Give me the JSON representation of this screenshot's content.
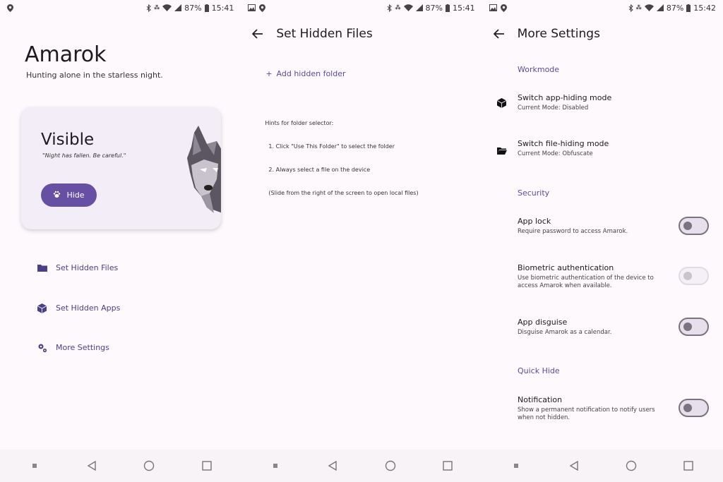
{
  "status_bars": [
    {
      "battery": "87%",
      "time": "15:41"
    },
    {
      "battery": "87%",
      "time": "15:41"
    },
    {
      "battery": "87%",
      "time": "15:42"
    }
  ],
  "home": {
    "title": "Amarok",
    "subtitle": "Hunting alone in the starless night.",
    "card": {
      "status": "Visible",
      "quote": "\"Night has fallen. Be careful.\"",
      "button_label": "Hide"
    },
    "menu": [
      {
        "label": "Set Hidden Files",
        "icon": "folder-icon"
      },
      {
        "label": "Set Hidden Apps",
        "icon": "cube-icon"
      },
      {
        "label": "More Settings",
        "icon": "gears-icon"
      }
    ]
  },
  "hidden_files": {
    "title": "Set Hidden Files",
    "add_label": "Add hidden folder",
    "hints": [
      "Hints for folder selector:",
      "  1. Click \"Use This Folder\" to select the folder",
      "  2. Always select a file on the device",
      "  (Slide from the right of the screen to open local files)"
    ]
  },
  "more_settings": {
    "title": "More Settings",
    "sections": {
      "workmode": "Workmode",
      "security": "Security",
      "quick_hide": "Quick Hide"
    },
    "items": {
      "app_hiding": {
        "title": "Switch app-hiding mode",
        "subtitle": "Current Mode: Disabled"
      },
      "file_hiding": {
        "title": "Switch file-hiding mode",
        "subtitle": "Current Mode: Obfuscate"
      },
      "app_lock": {
        "title": "App lock",
        "subtitle": "Require password to access Amarok.",
        "enabled": false
      },
      "biometric": {
        "title": "Biometric authentication",
        "subtitle": "Use biometric authentication of the device to access Amarok when available.",
        "enabled": false,
        "disabled": true
      },
      "disguise": {
        "title": "App disguise",
        "subtitle": "Disguise Amarok as a calendar.",
        "enabled": false
      },
      "notification": {
        "title": "Notification",
        "subtitle": "Show a permanent notification to notify users when not hidden.",
        "enabled": false
      }
    }
  },
  "colors": {
    "accent": "#6750a4",
    "background": "#fdf9fd",
    "menu_text": "#4a3f88"
  }
}
